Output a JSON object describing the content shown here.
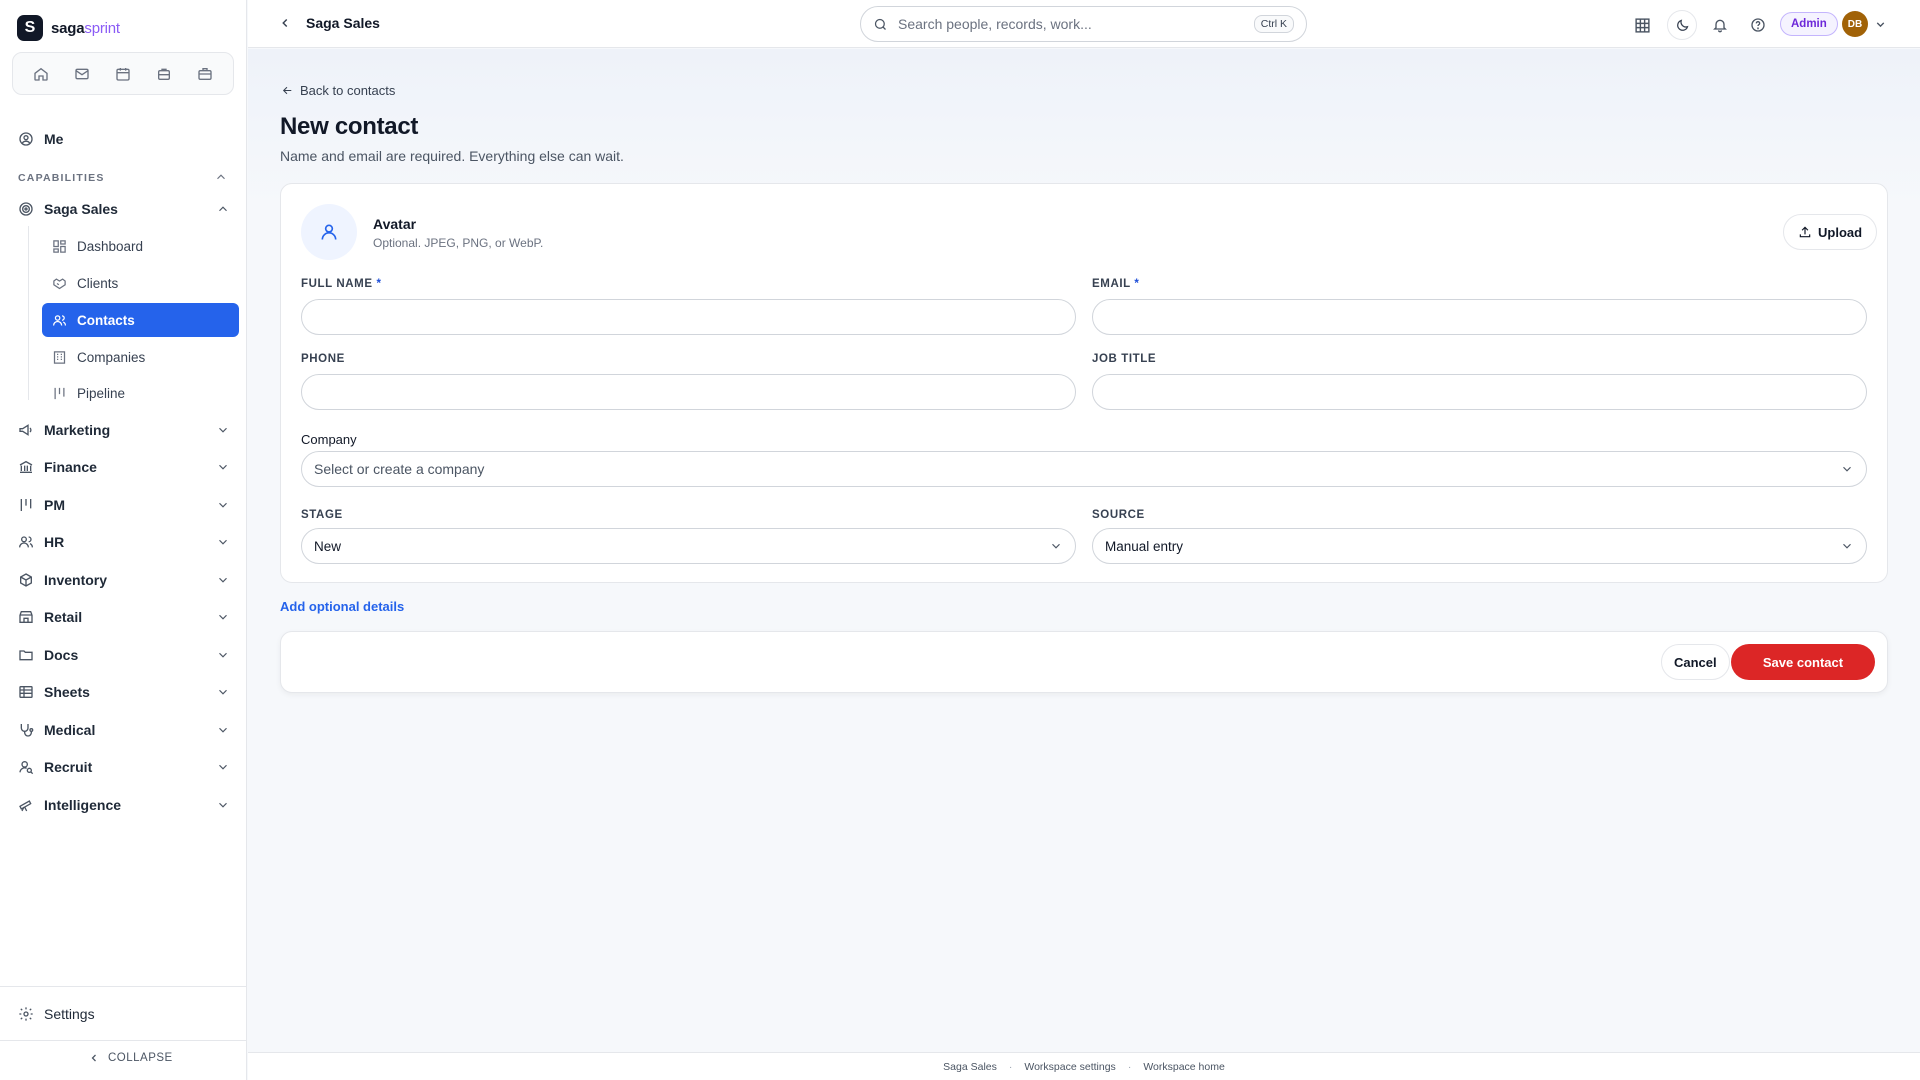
{
  "brand": {
    "mark": "S",
    "name_main": "saga",
    "name_accent": "sprint"
  },
  "quick_icons": [
    "home-icon",
    "mail-icon",
    "calendar-icon",
    "inbox-icon",
    "briefcase-icon"
  ],
  "sidebar": {
    "me": "Me",
    "capabilities_label": "CAPABILITIES",
    "active_group": "Saga Sales",
    "sub_items": [
      {
        "label": "Dashboard",
        "icon": "dashboard-icon"
      },
      {
        "label": "Clients",
        "icon": "handshake-icon"
      },
      {
        "label": "Contacts",
        "icon": "users-icon",
        "active": true
      },
      {
        "label": "Companies",
        "icon": "building-icon"
      },
      {
        "label": "Pipeline",
        "icon": "pipeline-icon"
      }
    ],
    "groups": [
      {
        "label": "Marketing",
        "icon": "megaphone-icon"
      },
      {
        "label": "Finance",
        "icon": "bank-icon"
      },
      {
        "label": "PM",
        "icon": "kanban-icon"
      },
      {
        "label": "HR",
        "icon": "people-icon"
      },
      {
        "label": "Inventory",
        "icon": "box-icon"
      },
      {
        "label": "Retail",
        "icon": "store-icon"
      },
      {
        "label": "Docs",
        "icon": "folder-icon"
      },
      {
        "label": "Sheets",
        "icon": "table-icon"
      },
      {
        "label": "Medical",
        "icon": "stethoscope-icon"
      },
      {
        "label": "Recruit",
        "icon": "user-search-icon"
      },
      {
        "label": "Intelligence",
        "icon": "telescope-icon"
      }
    ],
    "settings": "Settings",
    "collapse": "COLLAPSE"
  },
  "topbar": {
    "title": "Saga Sales",
    "search_placeholder": "Search people, records, work...",
    "shortcut": "Ctrl K",
    "admin_badge": "Admin",
    "avatar_initials": "DB"
  },
  "page": {
    "back_link": "Back to contacts",
    "title": "New contact",
    "subtitle": "Name and email are required. Everything else can wait."
  },
  "form": {
    "avatar_title": "Avatar",
    "avatar_hint": "Optional. JPEG, PNG, or WebP.",
    "upload_label": "Upload",
    "full_name_label": "FULL NAME",
    "email_label": "EMAIL",
    "required_mark": "*",
    "phone_label": "PHONE",
    "job_title_label": "JOB TITLE",
    "company_label": "Company",
    "company_placeholder": "Select or create a company",
    "stage_label": "STAGE",
    "stage_value": "New",
    "source_label": "SOURCE",
    "source_value": "Manual entry",
    "full_name_value": "",
    "email_value": "",
    "phone_value": "",
    "job_title_value": ""
  },
  "add_details": "Add optional details",
  "actions": {
    "cancel": "Cancel",
    "save": "Save contact"
  },
  "footer_links": [
    "Saga Sales",
    "Workspace settings",
    "Workspace home"
  ],
  "colors": {
    "primary": "#2563eb",
    "danger": "#dc2626",
    "admin": "#6d28d9",
    "avatar_bg": "#a16207"
  }
}
